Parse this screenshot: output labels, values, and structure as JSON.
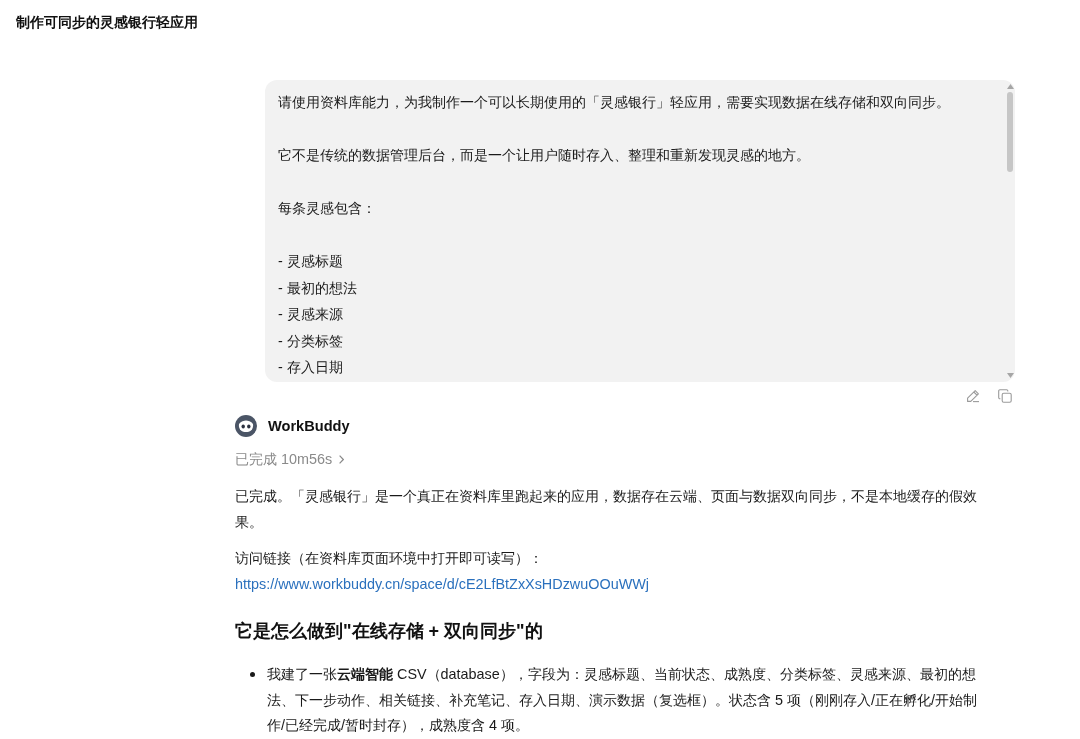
{
  "page_title": "制作可同步的灵感银行轻应用",
  "user_message": {
    "paragraphs": [
      "请使用资料库能力，为我制作一个可以长期使用的「灵感银行」轻应用，需要实现数据在线存储和双向同步。",
      "它不是传统的数据管理后台，而是一个让用户随时存入、整理和重新发现灵感的地方。",
      "每条灵感包含："
    ],
    "list_items": [
      "- 灵感标题",
      "- 最初的想法",
      "- 灵感来源",
      "- 分类标签",
      "- 存入日期"
    ]
  },
  "assistant": {
    "name": "WorkBuddy",
    "status": "已完成 10m56s",
    "paragraphs": [
      "已完成。「灵感银行」是一个真正在资料库里跑起来的应用，数据存在云端、页面与数据双向同步，不是本地缓存的假效果。",
      "访问链接（在资料库页面环境中打开即可读写）："
    ],
    "link": "https://www.workbuddy.cn/space/d/cE2LfBtZxXsHDzwuOOuWWj",
    "heading": "它是怎么做到\"在线存储 + 双向同步\"的",
    "bullets": [
      "我建了一张**云端智能** CSV（database），字段为：灵感标题、当前状态、成熟度、分类标签、灵感来源、最初的想法、下一步动作、相关链接、补充笔记、存入日期、演示数据（复选框）。状态含 5 项（刚刚存入/正在孵化/开始制作/已经完成/暂时封存），成熟度含 4 项。"
    ]
  }
}
